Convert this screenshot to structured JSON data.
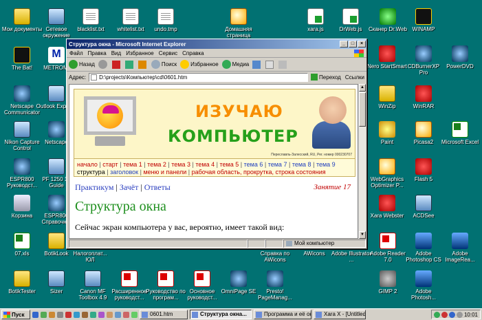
{
  "desktop": {
    "icons": [
      {
        "label": "Мои документы"
      },
      {
        "label": "Сетевое окружение"
      },
      {
        "label": "blacklist.txt"
      },
      {
        "label": "whitelist.txt"
      },
      {
        "label": "undo.tmp"
      },
      {
        "label": "Домашняя страница"
      },
      {
        "label": "xara.js"
      },
      {
        "label": "DrWeb.js"
      },
      {
        "label": "Сканер Dr.Web"
      },
      {
        "label": "WINAMP"
      },
      {
        "label": "The Bat!"
      },
      {
        "label": "METROMI"
      },
      {
        "label": "Nero StartSmart"
      },
      {
        "label": "CDBurnerXP Pro"
      },
      {
        "label": "PowerDVD"
      },
      {
        "label": "Netscape Communicator"
      },
      {
        "label": "Outlook Express"
      },
      {
        "label": "WinZip"
      },
      {
        "label": "WinRAR"
      },
      {
        "label": "Nikon Capture Control"
      },
      {
        "label": "Netscape"
      },
      {
        "label": "Paint"
      },
      {
        "label": "Picasa2"
      },
      {
        "label": "Microsoft Excel"
      },
      {
        "label": "ESPR800 Руководст..."
      },
      {
        "label": "PF 1250 16 Guide"
      },
      {
        "label": "WebGraphics Optimizer P..."
      },
      {
        "label": "Flash 5"
      },
      {
        "label": "Корзина"
      },
      {
        "label": "ESPR800 Справочн..."
      },
      {
        "label": "Xara Webster"
      },
      {
        "label": "ACDSee"
      },
      {
        "label": "07.xls"
      },
      {
        "label": "BotikLook"
      },
      {
        "label": "Налогоплат... ЮЛ"
      },
      {
        "label": "Справка по AWicons"
      },
      {
        "label": "AWicons"
      },
      {
        "label": "Adobe Illustrator ..."
      },
      {
        "label": "Adobe Reader 7.0"
      },
      {
        "label": "Adobe Photoshop CS"
      },
      {
        "label": "Adobe ImageRea..."
      },
      {
        "label": "BotikTester"
      },
      {
        "label": "Sizer"
      },
      {
        "label": "Canon MF Toolbox 4.9"
      },
      {
        "label": "Расширенное руководст..."
      },
      {
        "label": "Руководство по програм..."
      },
      {
        "label": "Основное руководст..."
      },
      {
        "label": "OmniPage SE"
      },
      {
        "label": "Presto! PageManag..."
      },
      {
        "label": "GIMP 2"
      },
      {
        "label": "Adobe Photosh..."
      }
    ]
  },
  "window": {
    "title": "Структура окна - Microsoft Internet Explorer",
    "controls": {
      "minimize": "_",
      "maximize": "□",
      "close": "×"
    },
    "menu": [
      "Файл",
      "Правка",
      "Вид",
      "Избранное",
      "Сервис",
      "Справка"
    ],
    "toolbar": {
      "back": "Назад",
      "search": "Поиск",
      "favorites": "Избранное",
      "media": "Медиа"
    },
    "address": {
      "label": "Адрес:",
      "value": "D:\\projects\\Компьютер\\cd\\0601.htm",
      "go": "Переход",
      "links": "Ссылки"
    },
    "status": {
      "zone": "Мой компьютер"
    },
    "scroll_up": "▲",
    "scroll_down": "▼"
  },
  "page": {
    "banner": {
      "line1": "ИЗУЧАЮ",
      "line2": "КОМПЬЮТЕР",
      "caption": "Переславль-Залесский, RU, Рег. номер 000230707"
    },
    "nav_row1": [
      {
        "text": "начало",
        "accent": "red"
      },
      {
        "text": "старт",
        "accent": "red"
      },
      {
        "text": "тема 1",
        "accent": "red"
      },
      {
        "text": "тема 2",
        "accent": "red"
      },
      {
        "text": "тема 3",
        "accent": "red"
      },
      {
        "text": "тема 4",
        "accent": "red"
      },
      {
        "text": "тема 5",
        "accent": "red"
      },
      {
        "text": "тема 6",
        "accent": "blue"
      },
      {
        "text": "тема 7",
        "accent": "blue"
      },
      {
        "text": "тема 8",
        "accent": "blue"
      },
      {
        "text": "тема 9",
        "accent": "blue"
      }
    ],
    "nav_row2": [
      {
        "text": "структура"
      },
      {
        "text": "заголовок"
      },
      {
        "text": "меню и панели"
      },
      {
        "text": "рабочая область, прокрутка, строка состояния"
      }
    ],
    "crumbs": [
      "Практикум",
      "Зачёт",
      "Ответы"
    ],
    "crumb_sep": "|",
    "nav_sep": "|",
    "lesson": "Занятие 17",
    "heading": "Структура окна",
    "paragraph": "Сейчас экран компьютера у вас, вероятно, имеет такой вид:"
  },
  "taskbar": {
    "start": "Пуск",
    "tasks": [
      {
        "label": "0601.htm"
      },
      {
        "label": "Структура окна..."
      },
      {
        "label": "Программа и её ок..."
      },
      {
        "label": "Xara X - [Untitled1 *]"
      }
    ],
    "clock": "10:01"
  },
  "colors": {
    "desktop": "#017172",
    "title_active": "#0a246a",
    "nav_red": "#c00000",
    "nav_blue": "#1f3fbf",
    "heading_green": "#1e8f1e",
    "banner_orange": "#f78e00",
    "banner_green": "#26a01a"
  }
}
